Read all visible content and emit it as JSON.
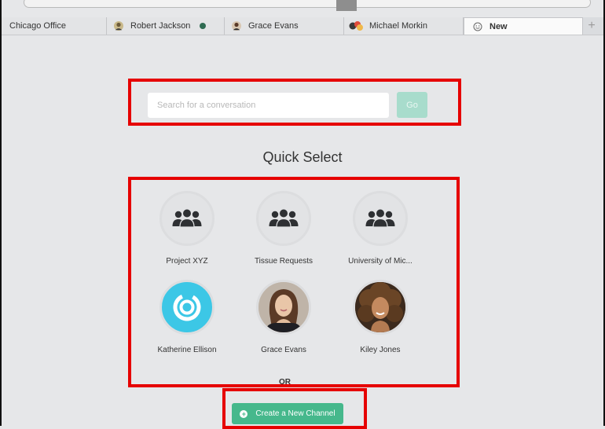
{
  "tabs": [
    {
      "label": "Chicago Office",
      "icon": "none",
      "has_badge": false
    },
    {
      "label": "Robert Jackson",
      "icon": "user-avatar-icon",
      "has_badge": true
    },
    {
      "label": "Grace Evans",
      "icon": "user-avatar-icon",
      "has_badge": false
    },
    {
      "label": "Michael Morkin",
      "icon": "group-avatar-icon",
      "has_badge": false
    },
    {
      "label": "New",
      "icon": "smiley-icon",
      "active": true
    }
  ],
  "search": {
    "placeholder": "Search for a conversation",
    "go_label": "Go"
  },
  "quick_select": {
    "title": "Quick Select",
    "items": [
      {
        "label": "Project XYZ",
        "type": "group",
        "icon": "group-icon"
      },
      {
        "label": "Tissue Requests",
        "type": "group",
        "icon": "group-icon"
      },
      {
        "label": "University of Mic...",
        "type": "group",
        "icon": "group-icon"
      },
      {
        "label": "Katherine Ellison",
        "type": "user",
        "icon": "ring-logo-avatar"
      },
      {
        "label": "Grace Evans",
        "type": "user",
        "icon": "photo-avatar"
      },
      {
        "label": "Kiley Jones",
        "type": "user",
        "icon": "photo-avatar"
      }
    ]
  },
  "or_label": "OR",
  "create_channel": {
    "label": "Create a New Channel",
    "icon": "plus-circle-icon"
  },
  "colors": {
    "accent": "#46b88c",
    "go_button": "#a8dccc",
    "highlight": "#e60000",
    "background": "#e6e7e9"
  }
}
